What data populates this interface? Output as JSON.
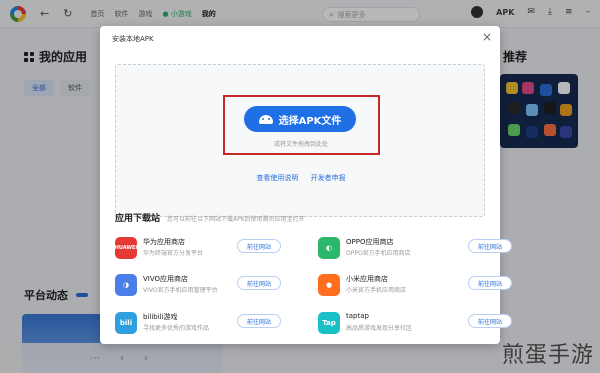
{
  "topbar": {
    "nav": [
      "首页",
      "软件",
      "游戏",
      "小游戏",
      "我的"
    ],
    "active_nav": "我的",
    "search_placeholder": "搜索更多",
    "apk_label": "APK"
  },
  "background": {
    "section_title": "我的应用",
    "filters": [
      "全部",
      "软件"
    ],
    "right_title_fragment": "推荐",
    "platform_title": "平台动态"
  },
  "modal": {
    "title": "安装本地APK",
    "close": "×",
    "pick_button": "选择APK文件",
    "drop_hint": "或将文件拖拽到此处",
    "links": [
      "查看使用说明",
      "开发者申报"
    ],
    "sites_title": "应用下载站",
    "sites_subtitle": "您可以前往以下网站下载APK后使用腾讯应用宝打开",
    "go_label": "前往网站",
    "sites": [
      {
        "name": "华为应用商店",
        "desc": "华为终端官方分发平台",
        "logo_text": "HUAWEI",
        "color": "#e53935"
      },
      {
        "name": "OPPO应用商店",
        "desc": "OPPO官方手机应用商店",
        "logo_text": "",
        "color": "#2bb86a"
      },
      {
        "name": "VIVO应用商店",
        "desc": "VIVO官方手机应用管理平台",
        "logo_text": "",
        "color": "#4a7fe8"
      },
      {
        "name": "小米应用商店",
        "desc": "小米官方手机应用商店",
        "logo_text": "",
        "color": "#ff6d1f"
      },
      {
        "name": "bilibili游戏",
        "desc": "寻找更多优秀的游戏作品",
        "logo_text": "bili",
        "color": "#2f9fe0"
      },
      {
        "name": "taptap",
        "desc": "高品质游戏发现分享社区",
        "logo_text": "Tap",
        "color": "#19c0c5"
      }
    ]
  },
  "watermark": "煎蛋手游"
}
